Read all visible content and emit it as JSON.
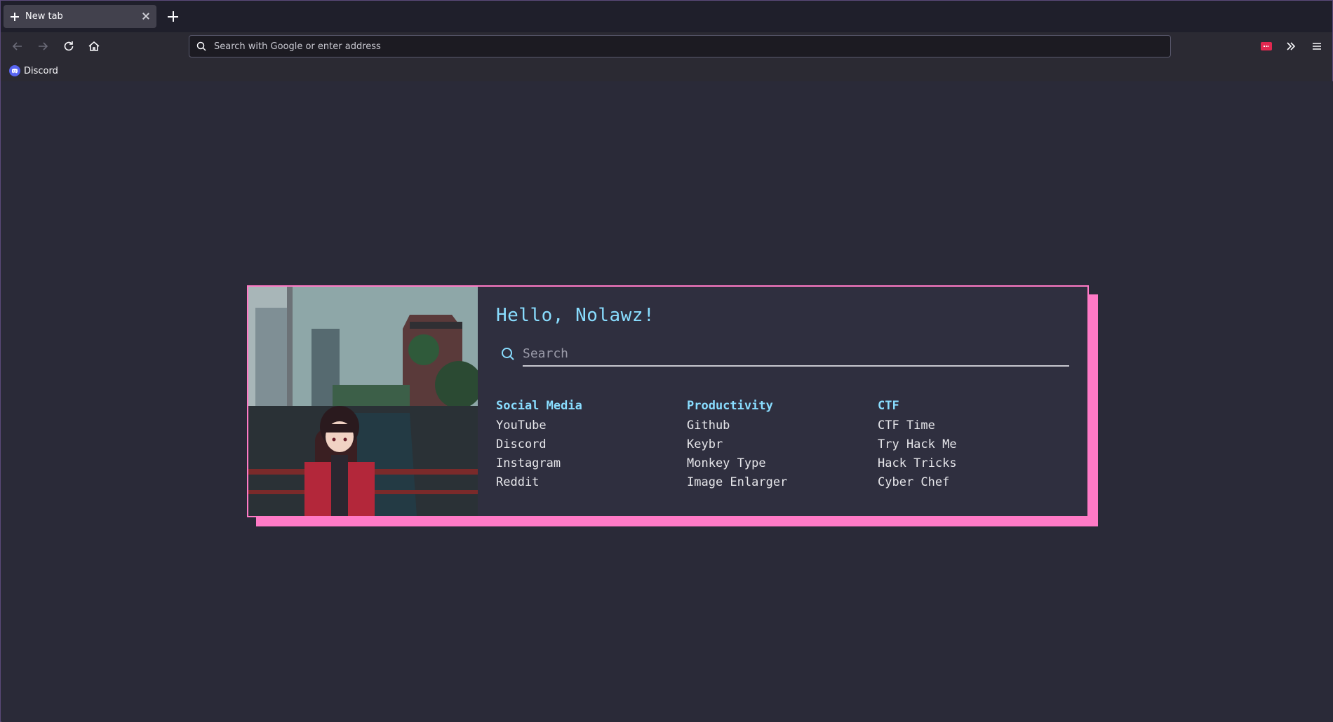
{
  "browser": {
    "tab_title": "New tab",
    "url_placeholder": "Search with Google or enter address",
    "bookmarks": [
      {
        "label": "Discord",
        "icon": "discord-icon"
      }
    ],
    "accent_color": "#ff7ac6"
  },
  "startpage": {
    "greeting": "Hello, Nolawz!",
    "search_placeholder": "Search",
    "columns": [
      {
        "title": "Social Media",
        "links": [
          "YouTube",
          "Discord",
          "Instagram",
          "Reddit"
        ]
      },
      {
        "title": "Productivity",
        "links": [
          "Github",
          "Keybr",
          "Monkey Type",
          "Image Enlarger"
        ]
      },
      {
        "title": "CTF",
        "links": [
          "CTF Time",
          "Try Hack Me",
          "Hack Tricks",
          "Cyber Chef"
        ]
      }
    ],
    "heading_color": "#89ddff",
    "border_color": "#ff7ac6"
  }
}
